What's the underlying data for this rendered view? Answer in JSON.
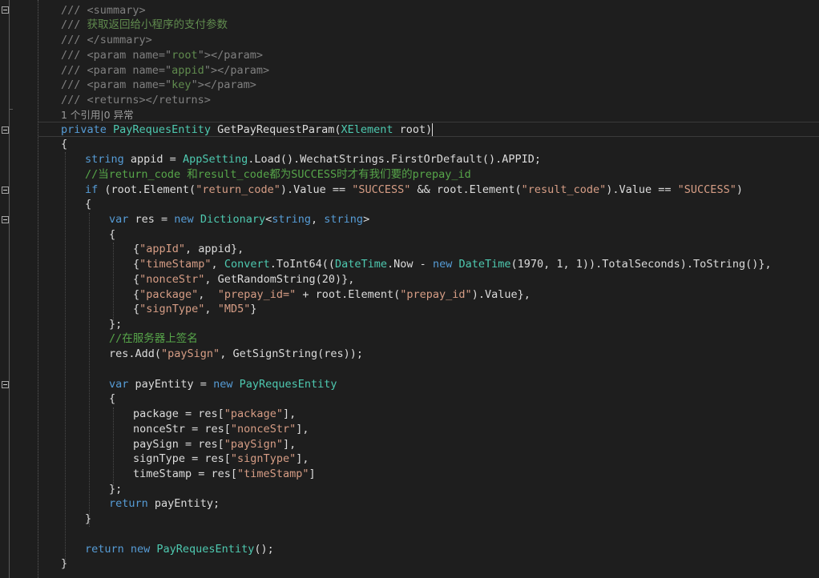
{
  "editor": {
    "codelens": "1 个引用|0 异常",
    "lines": {
      "l1": [
        [
          "dg",
          "/// <summary>"
        ]
      ],
      "l2": [
        [
          "dg",
          "/// "
        ],
        [
          "dc",
          "获取返回给小程序的支付参数"
        ]
      ],
      "l3": [
        [
          "dg",
          "/// </summary>"
        ]
      ],
      "l4": [
        [
          "dg",
          "/// <param name=\""
        ],
        [
          "dc",
          "root"
        ],
        [
          "dg",
          "\"></param>"
        ]
      ],
      "l5": [
        [
          "dg",
          "/// <param name=\""
        ],
        [
          "dc",
          "appid"
        ],
        [
          "dg",
          "\"></param>"
        ]
      ],
      "l6": [
        [
          "dg",
          "/// <param name=\""
        ],
        [
          "dc",
          "key"
        ],
        [
          "dg",
          "\"></param>"
        ]
      ],
      "l7": [
        [
          "dg",
          "/// <returns></returns>"
        ]
      ],
      "l9": [
        [
          "kw",
          "private "
        ],
        [
          "ty",
          "PayRequesEntity "
        ],
        [
          "pl",
          "GetPayRequestParam("
        ],
        [
          "ty",
          "XElement "
        ],
        [
          "pl",
          "root)"
        ]
      ],
      "l10": [
        [
          "pl",
          "{"
        ]
      ],
      "l11": [
        [
          "kw",
          "string "
        ],
        [
          "pl",
          "appid = "
        ],
        [
          "ty",
          "AppSetting"
        ],
        [
          "pl",
          ".Load().WechatStrings.FirstOrDefault().APPID;"
        ]
      ],
      "l12": [
        [
          "cm",
          "//当return_code 和result_code都为SUCCESS时才有我们要的prepay_id"
        ]
      ],
      "l13": [
        [
          "kw",
          "if "
        ],
        [
          "pl",
          "(root.Element("
        ],
        [
          "st",
          "\"return_code\""
        ],
        [
          "pl",
          ").Value == "
        ],
        [
          "st",
          "\"SUCCESS\""
        ],
        [
          "pl",
          " && root.Element("
        ],
        [
          "st",
          "\"result_code\""
        ],
        [
          "pl",
          ").Value == "
        ],
        [
          "st",
          "\"SUCCESS\""
        ],
        [
          "pl",
          ")"
        ]
      ],
      "l14": [
        [
          "pl",
          "{"
        ]
      ],
      "l15": [
        [
          "kw",
          "var "
        ],
        [
          "pl",
          "res = "
        ],
        [
          "kw",
          "new "
        ],
        [
          "ty",
          "Dictionary"
        ],
        [
          "pl",
          "<"
        ],
        [
          "kw",
          "string"
        ],
        [
          "pl",
          ", "
        ],
        [
          "kw",
          "string"
        ],
        [
          "pl",
          ">"
        ]
      ],
      "l16": [
        [
          "pl",
          "{"
        ]
      ],
      "l17": [
        [
          "pl",
          "{"
        ],
        [
          "st",
          "\"appId\""
        ],
        [
          "pl",
          ", appid},"
        ]
      ],
      "l18": [
        [
          "pl",
          "{"
        ],
        [
          "st",
          "\"timeStamp\""
        ],
        [
          "pl",
          ", "
        ],
        [
          "ty",
          "Convert"
        ],
        [
          "pl",
          ".ToInt64(("
        ],
        [
          "ty",
          "DateTime"
        ],
        [
          "pl",
          ".Now - "
        ],
        [
          "kw",
          "new "
        ],
        [
          "ty",
          "DateTime"
        ],
        [
          "pl",
          "(1970, 1, 1)).TotalSeconds).ToString()},"
        ]
      ],
      "l19": [
        [
          "pl",
          "{"
        ],
        [
          "st",
          "\"nonceStr\""
        ],
        [
          "pl",
          ", GetRandomString(20)},"
        ]
      ],
      "l20": [
        [
          "pl",
          "{"
        ],
        [
          "st",
          "\"package\""
        ],
        [
          "pl",
          ",  "
        ],
        [
          "st",
          "\"prepay_id=\""
        ],
        [
          "pl",
          " + root.Element("
        ],
        [
          "st",
          "\"prepay_id\""
        ],
        [
          "pl",
          ").Value},"
        ]
      ],
      "l21": [
        [
          "pl",
          "{"
        ],
        [
          "st",
          "\"signType\""
        ],
        [
          "pl",
          ", "
        ],
        [
          "st",
          "\"MD5\""
        ],
        [
          "pl",
          "}"
        ]
      ],
      "l22": [
        [
          "pl",
          "};"
        ]
      ],
      "l23": [
        [
          "cm",
          "//在服务器上签名"
        ]
      ],
      "l24": [
        [
          "pl",
          "res.Add("
        ],
        [
          "st",
          "\"paySign\""
        ],
        [
          "pl",
          ", GetSignString(res));"
        ]
      ],
      "l26": [
        [
          "kw",
          "var "
        ],
        [
          "pl",
          "payEntity = "
        ],
        [
          "kw",
          "new "
        ],
        [
          "ty",
          "PayRequesEntity"
        ]
      ],
      "l27": [
        [
          "pl",
          "{"
        ]
      ],
      "l28": [
        [
          "pl",
          "package = res["
        ],
        [
          "st",
          "\"package\""
        ],
        [
          "pl",
          "],"
        ]
      ],
      "l29": [
        [
          "pl",
          "nonceStr = res["
        ],
        [
          "st",
          "\"nonceStr\""
        ],
        [
          "pl",
          "],"
        ]
      ],
      "l30": [
        [
          "pl",
          "paySign = res["
        ],
        [
          "st",
          "\"paySign\""
        ],
        [
          "pl",
          "],"
        ]
      ],
      "l31": [
        [
          "pl",
          "signType = res["
        ],
        [
          "st",
          "\"signType\""
        ],
        [
          "pl",
          "],"
        ]
      ],
      "l32": [
        [
          "pl",
          "timeStamp = res["
        ],
        [
          "st",
          "\"timeStamp\""
        ],
        [
          "pl",
          "]"
        ]
      ],
      "l33": [
        [
          "pl",
          "};"
        ]
      ],
      "l34": [
        [
          "kw",
          "return "
        ],
        [
          "pl",
          "payEntity;"
        ]
      ],
      "l35": [
        [
          "pl",
          "}"
        ]
      ],
      "l37": [
        [
          "kw",
          "return new "
        ],
        [
          "ty",
          "PayRequesEntity"
        ],
        [
          "pl",
          "();"
        ]
      ],
      "l38": [
        [
          "pl",
          "}"
        ]
      ]
    }
  }
}
